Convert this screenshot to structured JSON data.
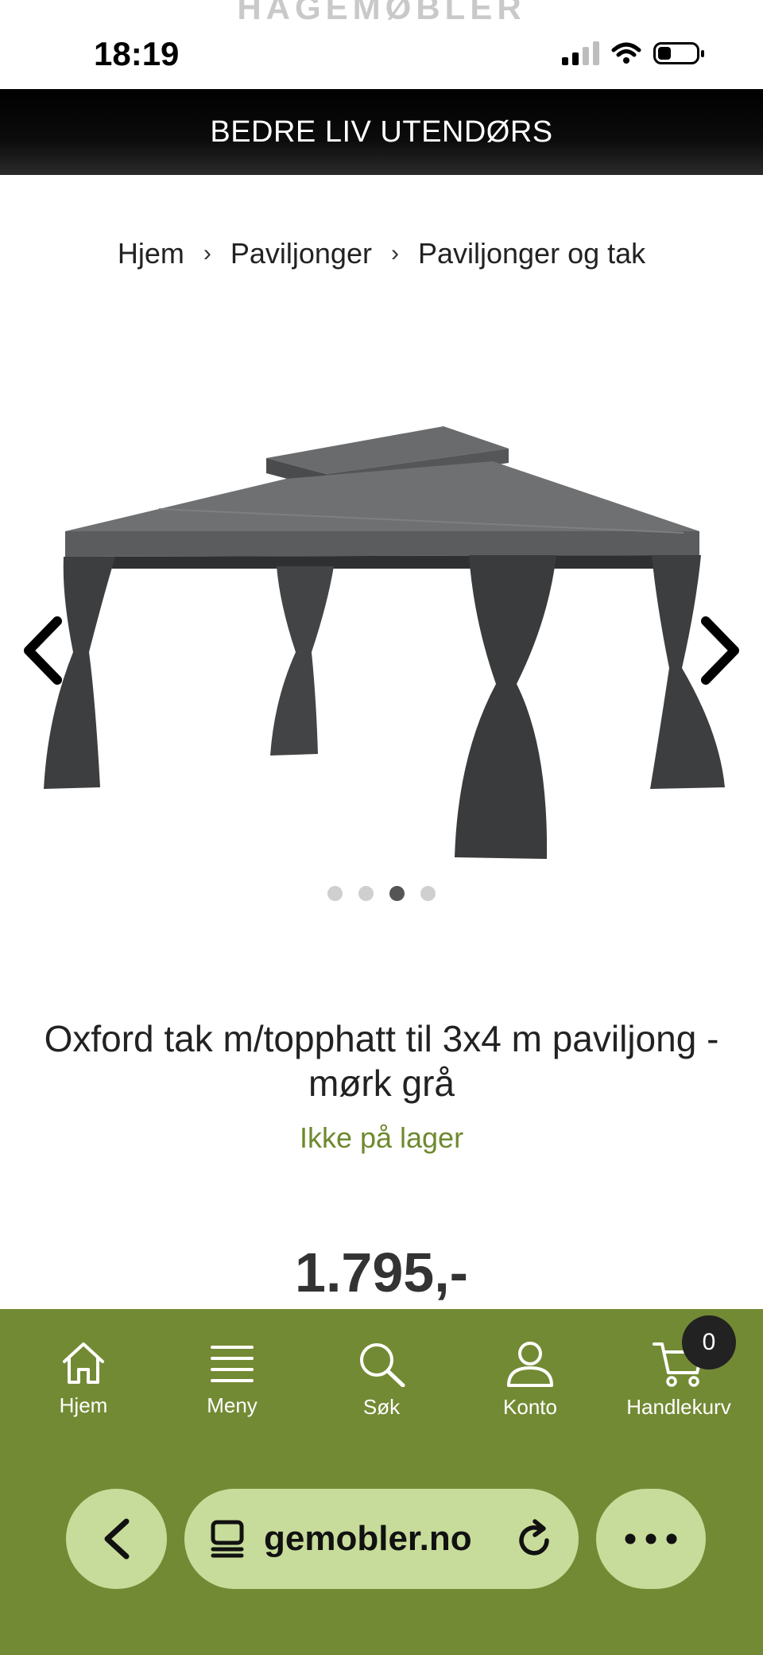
{
  "status_bar": {
    "background_logo": "HAGEMØBLER",
    "time": "18:19"
  },
  "promo_banner": {
    "text": "BEDRE LIV UTENDØRS"
  },
  "breadcrumb": {
    "items": [
      "Hjem",
      "Paviljonger",
      "Paviljonger og tak"
    ]
  },
  "gallery": {
    "image_count": 4,
    "active_index": 2,
    "prev_icon": "chevron-left-icon",
    "next_icon": "chevron-right-icon"
  },
  "product": {
    "title": "Oxford tak m/topphatt til 3x4 m paviljong - mørk grå",
    "stock_status": "Ikke på lager",
    "stock_color": "#6e8a2e",
    "price": "1.795,-"
  },
  "bottom_nav": {
    "background": "#738a34",
    "items": [
      {
        "label": "Hjem",
        "icon": "home-icon"
      },
      {
        "label": "Meny",
        "icon": "menu-icon"
      },
      {
        "label": "Søk",
        "icon": "search-icon"
      },
      {
        "label": "Konto",
        "icon": "user-icon"
      },
      {
        "label": "Handlekurv",
        "icon": "cart-icon"
      }
    ],
    "cart_count": "0"
  },
  "browser": {
    "url_text": "gemobler.no",
    "back_icon": "chevron-left-icon",
    "tabs_icon": "tabs-icon",
    "reload_icon": "reload-icon",
    "more_icon": "more-icon",
    "pill_color": "#c7dc9a"
  }
}
